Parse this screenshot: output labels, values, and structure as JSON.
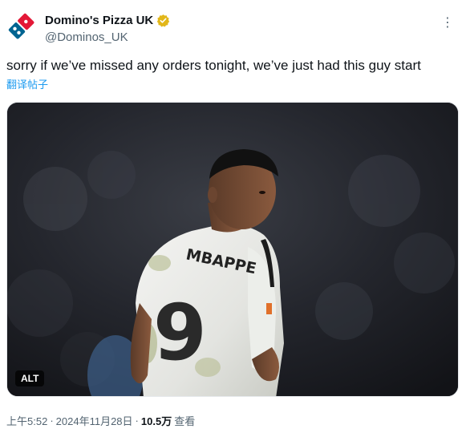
{
  "account": {
    "display_name": "Domino's Pizza UK",
    "handle": "@Dominos_UK",
    "verified_badge_icon": "verified-gold-badge-icon",
    "avatar_icon": "dominos-logo-icon"
  },
  "tweet": {
    "text": "sorry if we’ve missed any orders tonight, we’ve just had this guy start",
    "translate_label": "翻译帖子"
  },
  "media": {
    "alt_label": "ALT",
    "jersey_name": "MBAPPE",
    "jersey_number": "9"
  },
  "meta": {
    "time": "上午5:52",
    "separator": "·",
    "date": "2024年11月28日",
    "views_count": "10.5万",
    "views_label": "查看"
  },
  "menu": {
    "more_icon": "more-dots-icon"
  },
  "colors": {
    "link": "#1d9bf0",
    "muted": "#536471",
    "text": "#0f1419",
    "dominos_red": "#e31837",
    "dominos_blue": "#006491",
    "verified_gold": "#e2b719"
  }
}
